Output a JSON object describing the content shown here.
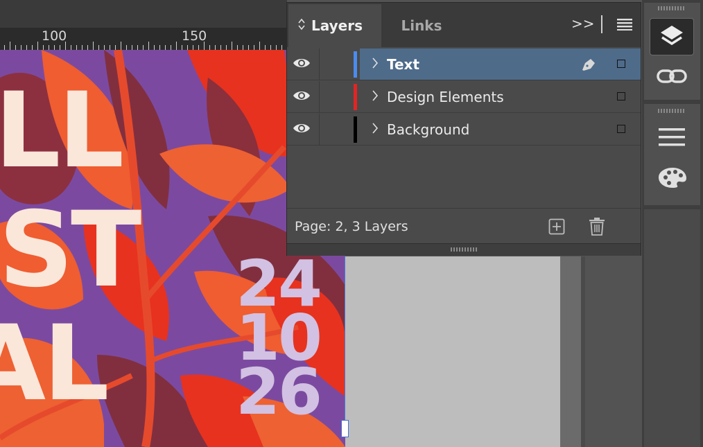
{
  "ruler": {
    "labels": [
      "100",
      "150"
    ]
  },
  "poster": {
    "line1": "LL",
    "line2": "ST",
    "line3": "AL",
    "date": [
      "24",
      "10",
      "26"
    ]
  },
  "panel": {
    "tabs": {
      "layers": "Layers",
      "links": "Links"
    },
    "menu_chevrons": ">>",
    "layers": [
      {
        "name": "Text",
        "color": "#4a8cf0",
        "selected": true
      },
      {
        "name": "Design Elements",
        "color": "#e22424",
        "selected": false
      },
      {
        "name": "Background",
        "color": "#000000",
        "selected": false
      }
    ],
    "status": "Page: 2, 3 Layers"
  },
  "dock": {
    "icons": [
      "layers-icon",
      "links-icon",
      "menu-lines-icon",
      "palette-icon"
    ]
  },
  "colors": {
    "selected_row": "#4e6b8a",
    "poster_purple": "#7b4aa0",
    "poster_red": "#e33a22",
    "poster_orange": "#ee6132"
  }
}
